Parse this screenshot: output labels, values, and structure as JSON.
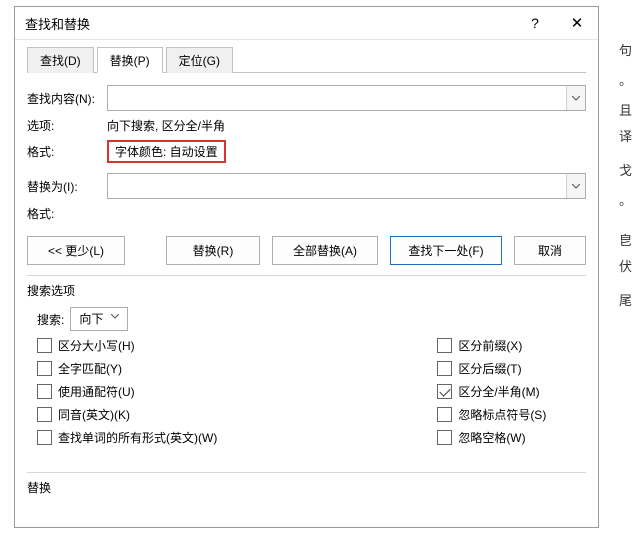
{
  "dialog": {
    "title": "查找和替换",
    "help": "?",
    "close": "✕"
  },
  "tabs": {
    "find": "查找(D)",
    "replace": "替换(P)",
    "goto": "定位(G)"
  },
  "findSection": {
    "label": "查找内容(N):",
    "value": "",
    "optionsLabel": "选项:",
    "optionsValue": "向下搜索, 区分全/半角",
    "formatLabel": "格式:",
    "formatValue": "字体颜色: 自动设置"
  },
  "replaceSection": {
    "label": "替换为(I):",
    "value": "",
    "formatLabel": "格式:"
  },
  "buttons": {
    "less": "<< 更少(L)",
    "replace": "替换(R)",
    "replaceAll": "全部替换(A)",
    "findNext": "查找下一处(F)",
    "cancel": "取消"
  },
  "search": {
    "sectionTitle": "搜索选项",
    "label": "搜索:",
    "direction": "向下",
    "left": [
      {
        "label": "区分大小写(H)",
        "checked": false
      },
      {
        "label": "全字匹配(Y)",
        "checked": false
      },
      {
        "label": "使用通配符(U)",
        "checked": false
      },
      {
        "label": "同音(英文)(K)",
        "checked": false
      },
      {
        "label": "查找单词的所有形式(英文)(W)",
        "checked": false
      }
    ],
    "right": [
      {
        "label": "区分前缀(X)",
        "checked": false
      },
      {
        "label": "区分后缀(T)",
        "checked": false
      },
      {
        "label": "区分全/半角(M)",
        "checked": true
      },
      {
        "label": "忽略标点符号(S)",
        "checked": false
      },
      {
        "label": "忽略空格(W)",
        "checked": false
      }
    ]
  },
  "footer": {
    "title": "替换"
  },
  "bg": {
    "c1": "句",
    "c2": "。",
    "c3": "且",
    "c4": "译",
    "c5": "戈",
    "c6": "。",
    "c7": "皀",
    "c8": "伏",
    "c9": "尾"
  }
}
